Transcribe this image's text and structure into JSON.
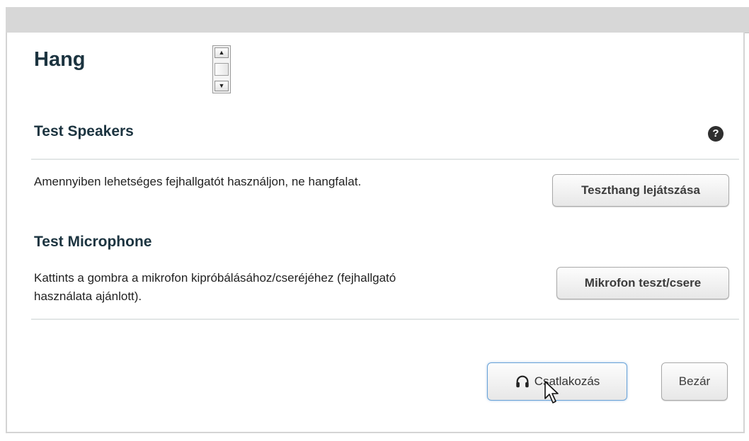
{
  "dialog": {
    "title": "Hang"
  },
  "speakers": {
    "title": "Test Speakers",
    "description": "Amennyiben lehetséges fejhallgatót használjon, ne hangfalat.",
    "button_label": "Teszthang lejátszása",
    "help_icon": "?"
  },
  "microphone": {
    "title": "Test Microphone",
    "description_line1": "Kattints a gombra a mikrofon kipróbálásához/cseréjéhez (fejhallgató",
    "description_line2": "használata ajánlott).",
    "button_label": "Mikrofon teszt/csere"
  },
  "footer": {
    "join_label": "Csatlakozás",
    "close_label": "Bezár"
  },
  "icons": {
    "help": "help-icon",
    "join": "headset-icon",
    "cursor": "mouse-pointer-icon",
    "spinner_up": "arrow-up-icon",
    "spinner_down": "arrow-down-icon"
  },
  "colors": {
    "title_text": "#1c3440",
    "join_border": "#6aa3d8",
    "header_bar": "#d7d7d7"
  }
}
